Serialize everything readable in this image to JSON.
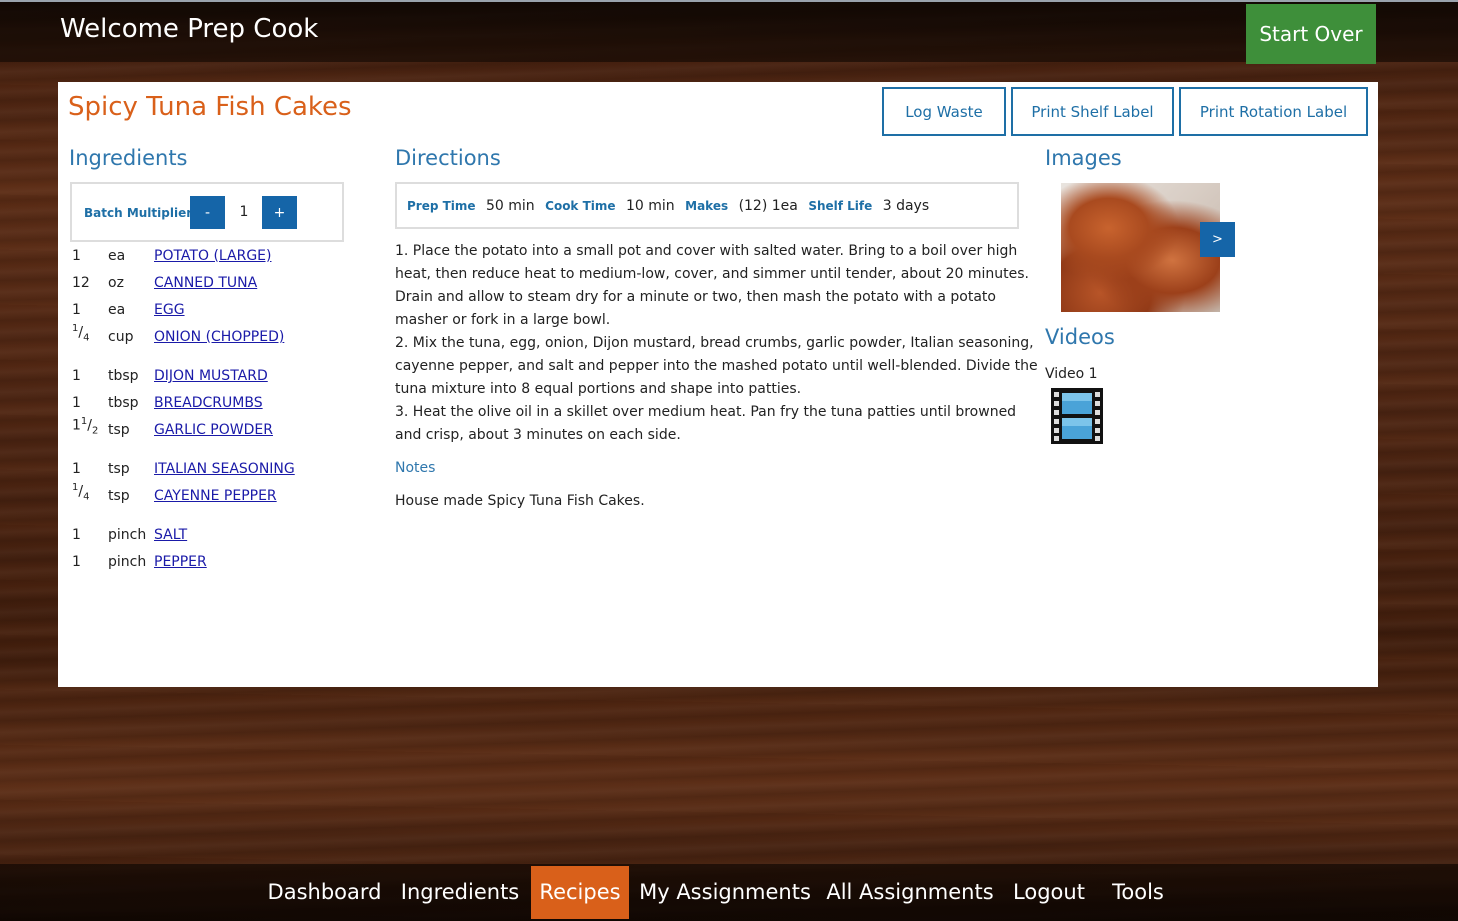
{
  "header": {
    "welcome": "Welcome Prep Cook",
    "start_over": "Start Over"
  },
  "recipe": {
    "title": "Spicy Tuna Fish Cakes",
    "actions": {
      "log_waste": "Log Waste",
      "print_shelf_label": "Print Shelf Label",
      "print_rotation_label": "Print Rotation Label"
    }
  },
  "ingredients": {
    "heading": "Ingredients",
    "batch_label": "Batch Multiplier",
    "decrement": "-",
    "increment": "+",
    "multiplier": "1",
    "items": [
      {
        "qty": "1",
        "unit": "ea",
        "name": "POTATO (LARGE)"
      },
      {
        "qty": "12",
        "unit": "oz",
        "name": "CANNED TUNA"
      },
      {
        "qty": "1",
        "unit": "ea",
        "name": "EGG"
      },
      {
        "qty_whole": "",
        "qty_num": "1",
        "qty_den": "4",
        "unit": "cup",
        "name": "ONION (CHOPPED)"
      },
      {
        "qty": "1",
        "unit": "tbsp",
        "name": "DIJON MUSTARD"
      },
      {
        "qty": "1",
        "unit": "tbsp",
        "name": "BREADCRUMBS"
      },
      {
        "qty_whole": "1",
        "qty_num": "1",
        "qty_den": "2",
        "unit": "tsp",
        "name": "GARLIC POWDER"
      },
      {
        "qty": "1",
        "unit": "tsp",
        "name": "ITALIAN SEASONING"
      },
      {
        "qty_whole": "",
        "qty_num": "1",
        "qty_den": "4",
        "unit": "tsp",
        "name": "CAYENNE PEPPER"
      },
      {
        "qty": "1",
        "unit": "pinch",
        "name": "SALT"
      },
      {
        "qty": "1",
        "unit": "pinch",
        "name": "PEPPER"
      }
    ]
  },
  "directions": {
    "heading": "Directions",
    "prep_time_label": "Prep Time",
    "prep_time": "50 min",
    "cook_time_label": "Cook Time",
    "cook_time": "10 min",
    "makes_label": "Makes",
    "makes": "(12) 1ea",
    "shelf_life_label": "Shelf Life",
    "shelf_life": "3 days",
    "steps": [
      "1. Place the potato into a small pot and cover with salted water. Bring to a boil over high heat, then reduce heat to medium-low, cover, and simmer until tender, about 20 minutes. Drain and allow to steam dry for a minute or two, then mash the potato with a potato masher or fork in a large bowl.",
      "2. Mix the tuna, egg, onion, Dijon mustard, bread crumbs, garlic powder, Italian seasoning, cayenne pepper, and salt and pepper into the mashed potato until well-blended. Divide the tuna mixture into 8 equal portions and shape into patties.",
      "3. Heat the olive oil in a skillet over medium heat. Pan fry the tuna patties until browned and crisp, about 3 minutes on each side."
    ],
    "notes_label": "Notes",
    "notes": "House made Spicy Tuna Fish Cakes."
  },
  "media": {
    "images_heading": "Images",
    "next": ">",
    "videos_heading": "Videos",
    "video_label": "Video 1"
  },
  "nav": {
    "items": [
      "Dashboard",
      "Ingredients",
      "Recipes",
      "My Assignments",
      "All Assignments",
      "Logout",
      "Tools"
    ],
    "active": "Recipes"
  },
  "colors": {
    "accent_orange": "#d9601a",
    "link_blue": "#1e6fa6",
    "start_green": "#3e8f3a"
  }
}
